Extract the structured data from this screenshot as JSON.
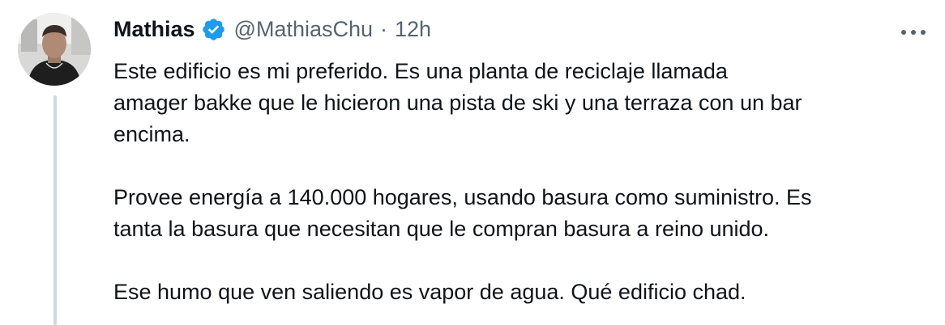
{
  "tweet": {
    "author": {
      "display_name": "Mathias",
      "handle": "@MathiasChu",
      "verified_icon": "verified-badge-icon",
      "avatar_icon": "avatar-photo"
    },
    "separator": "·",
    "timestamp": "12h",
    "more_icon": "more-options-icon",
    "body": {
      "paragraph_1_line_1": "Este edificio es mi preferido. Es una planta de reciclaje llamada",
      "paragraph_1_line_2": "amager bakke que le hicieron una pista de ski y una terraza con un bar",
      "paragraph_1_line_3": "encima.",
      "paragraph_2_line_1": "Provee energía a 140.000 hogares, usando basura como suministro. Es",
      "paragraph_2_line_2": "tanta la basura que necesitan que le compran basura a reino unido.",
      "paragraph_3_line_1": "Ese humo que ven saliendo es vapor de agua. Qué edificio chad."
    }
  },
  "colors": {
    "text_primary": "#0f1419",
    "text_secondary": "#536471",
    "verified_blue": "#1d9bf0",
    "thread_line": "#cfd9de"
  }
}
